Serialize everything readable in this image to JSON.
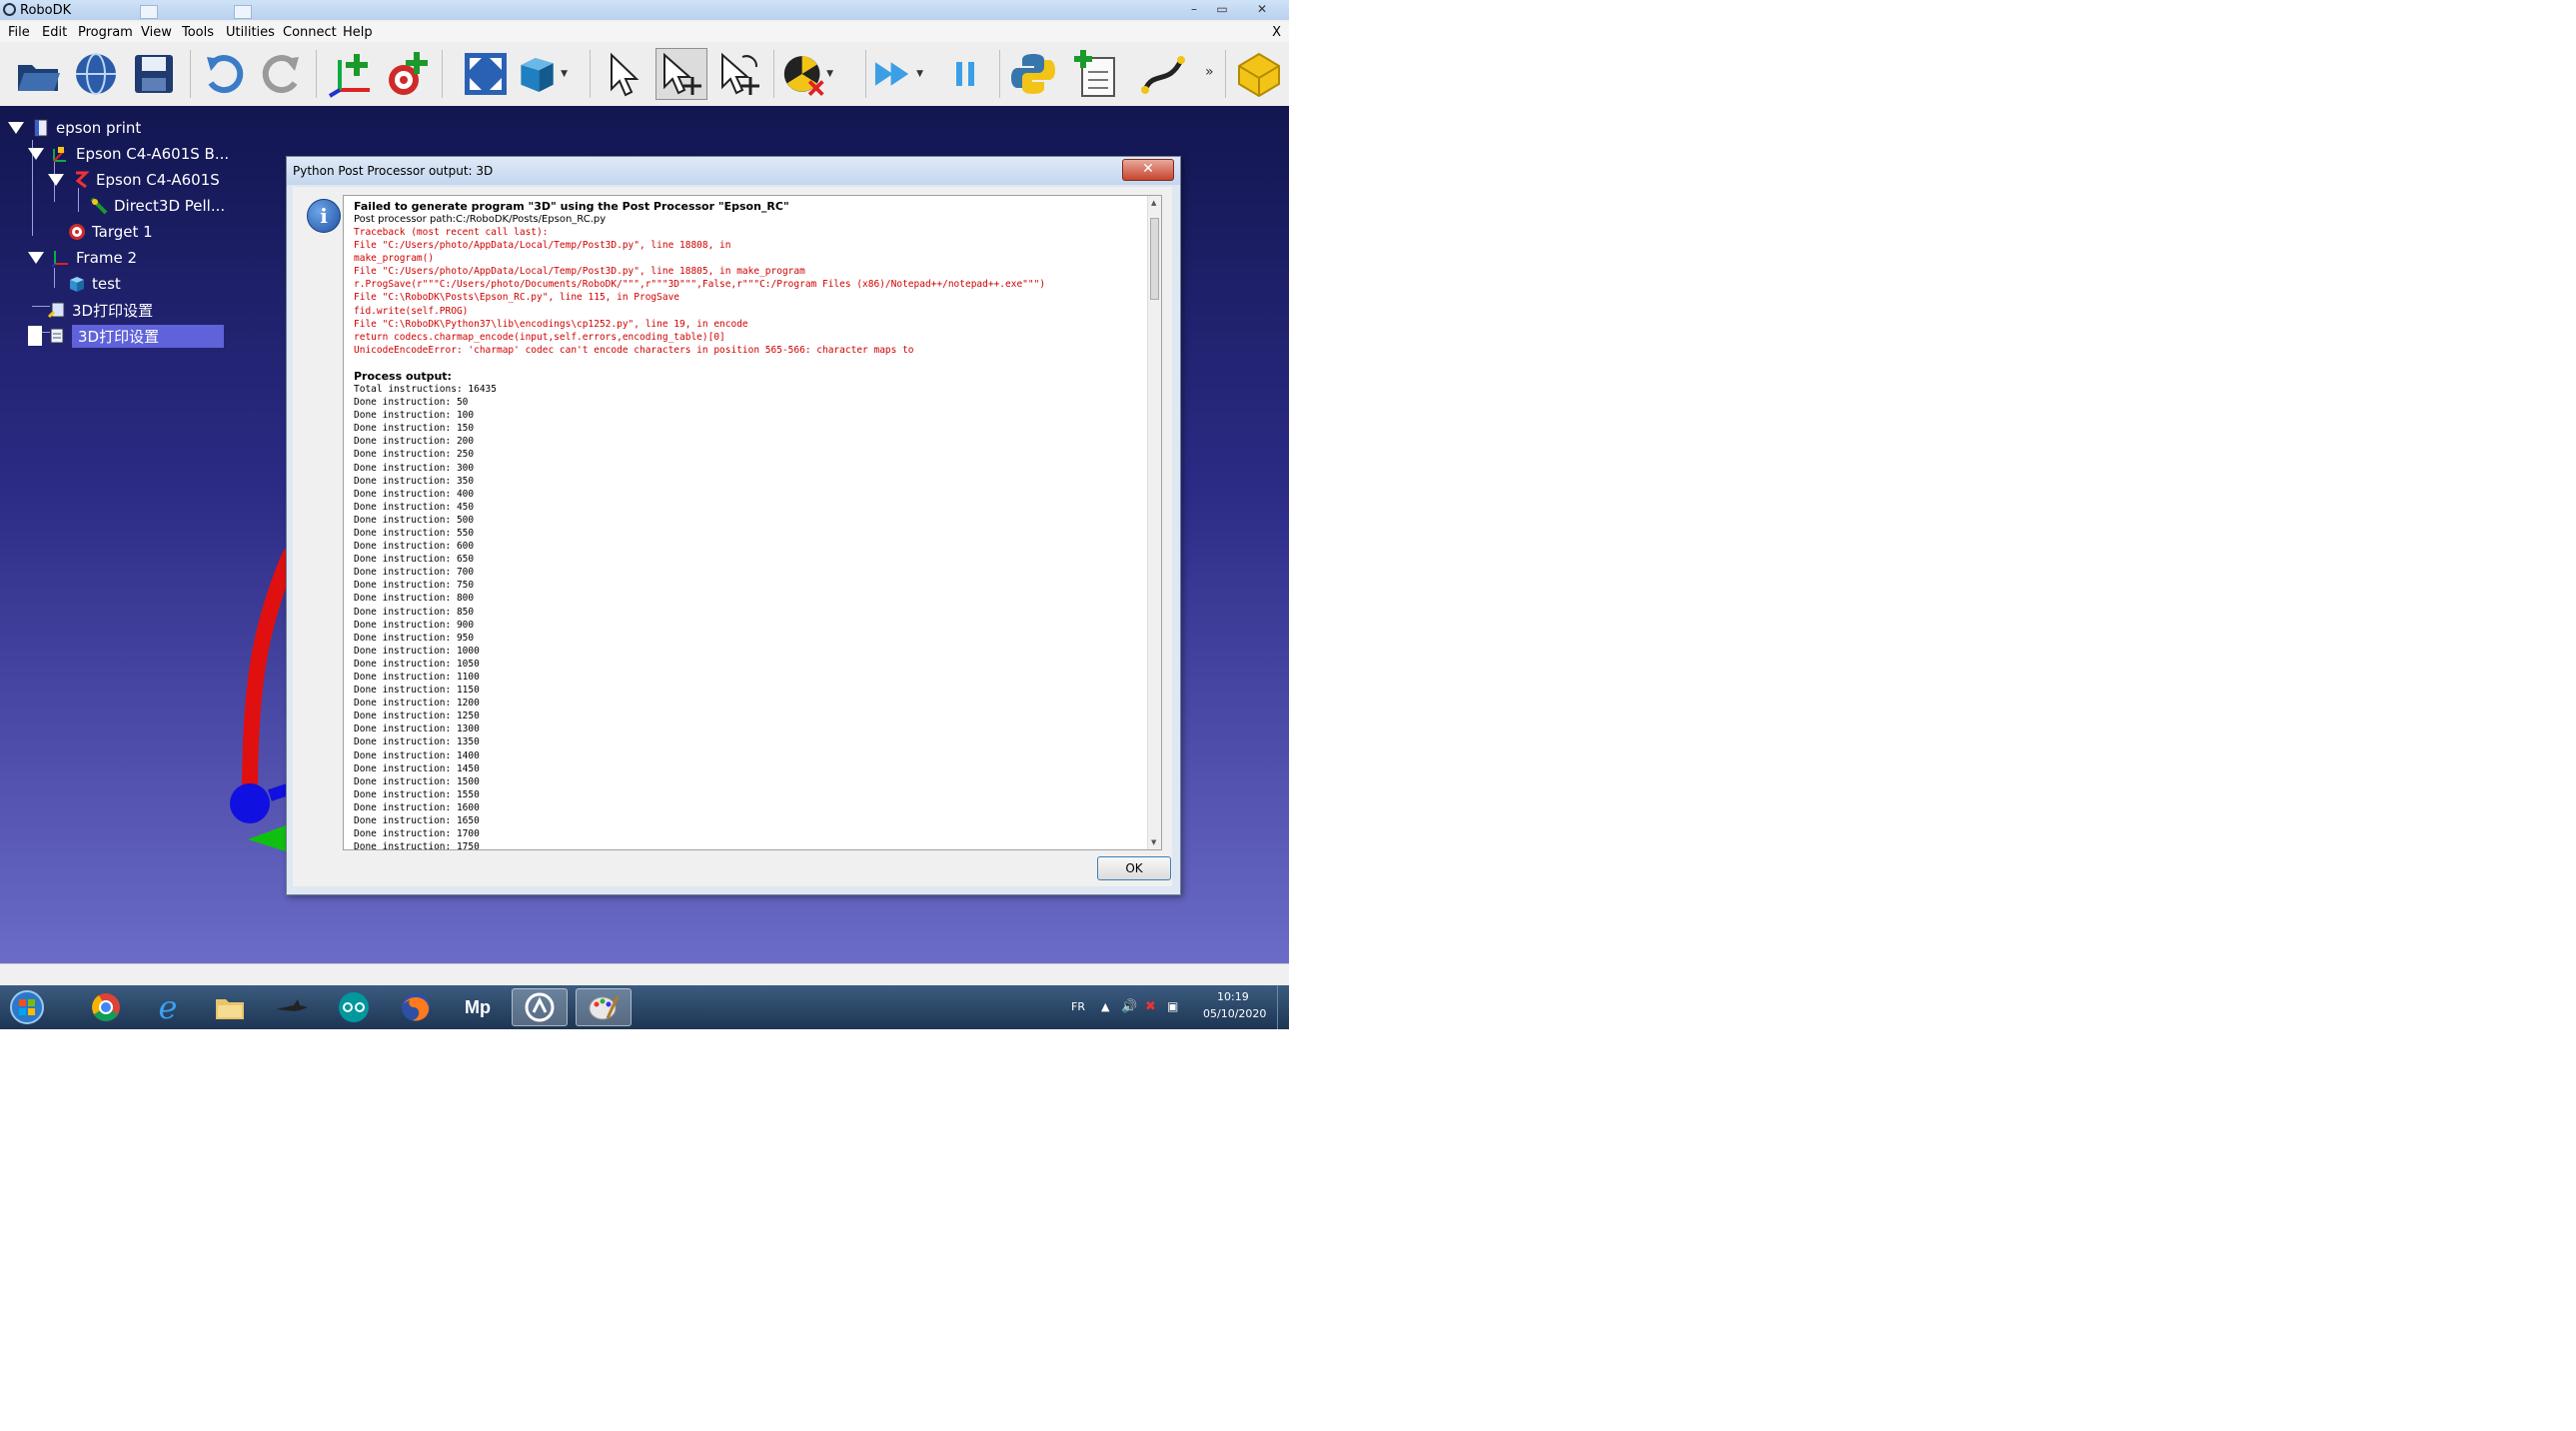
{
  "window": {
    "title": "RoboDK",
    "minimize": "–",
    "restore": "▭",
    "close": "✕"
  },
  "menu": {
    "items": [
      "File",
      "Edit",
      "Program",
      "View",
      "Tools",
      "Utilities",
      "Connect",
      "Help"
    ],
    "close": "X"
  },
  "toolbar": {
    "icons": [
      "open-icon",
      "web-library-icon",
      "save-icon",
      "undo-icon",
      "redo-icon",
      "add-frame-icon",
      "add-target-icon",
      "fit-all-icon",
      "view-cube-icon",
      "select-icon",
      "select-move-icon",
      "select-rotate-icon",
      "collision-icon",
      "run-program-icon",
      "pause-icon",
      "python-icon",
      "add-program-icon",
      "path-icon",
      "settings-icon"
    ],
    "more": "»"
  },
  "tree": {
    "items": [
      {
        "label": "epson print",
        "icon": "station-icon"
      },
      {
        "label": "Epson C4-A601S B...",
        "icon": "robot-base-icon"
      },
      {
        "label": "Epson C4-A601S",
        "icon": "robot-icon"
      },
      {
        "label": "Direct3D Pell...",
        "icon": "tool-icon"
      },
      {
        "label": "Target 1",
        "icon": "target-icon"
      },
      {
        "label": "Frame 2",
        "icon": "frame-icon"
      },
      {
        "label": "test",
        "icon": "object-icon"
      },
      {
        "label": "3D打印设置",
        "icon": "settings-item-icon"
      },
      {
        "label": "3D打印设置",
        "icon": "program-icon"
      }
    ]
  },
  "dialog": {
    "title": "Python Post Processor output: 3D",
    "close": "✕",
    "message_title": "Failed to generate program \"3D\" using the Post Processor \"Epson_RC\"",
    "path": "Post processor path:C:/RoboDK/Posts/Epson_RC.py",
    "traceback": [
      "Traceback (most recent call last):",
      "File \"C:/Users/photo/AppData/Local/Temp/Post3D.py\", line 18808, in",
      "make_program()",
      "File \"C:/Users/photo/AppData/Local/Temp/Post3D.py\", line 18805, in make_program",
      "r.ProgSave(r\"\"\"C:/Users/photo/Documents/RoboDK/\"\"\",r\"\"\"3D\"\"\",False,r\"\"\"C:/Program Files (x86)/Notepad++/notepad++.exe\"\"\")",
      "File \"C:\\RoboDK\\Posts\\Epson_RC.py\", line 115, in ProgSave",
      "fid.write(self.PROG)",
      "File \"C:\\RoboDK\\Python37\\lib\\encodings\\cp1252.py\", line 19, in encode",
      "return codecs.charmap_encode(input,self.errors,encoding_table)[0]",
      "UnicodeEncodeError: 'charmap' codec can't encode characters in position 565-566: character maps to"
    ],
    "output_heading": "Process output:",
    "output": [
      "Total instructions: 16435",
      "Done instruction: 50",
      "Done instruction: 100",
      "Done instruction: 150",
      "Done instruction: 200",
      "Done instruction: 250",
      "Done instruction: 300",
      "Done instruction: 350",
      "Done instruction: 400",
      "Done instruction: 450",
      "Done instruction: 500",
      "Done instruction: 550",
      "Done instruction: 600",
      "Done instruction: 650",
      "Done instruction: 700",
      "Done instruction: 750",
      "Done instruction: 800",
      "Done instruction: 850",
      "Done instruction: 900",
      "Done instruction: 950",
      "Done instruction: 1000",
      "Done instruction: 1050",
      "Done instruction: 1100",
      "Done instruction: 1150",
      "Done instruction: 1200",
      "Done instruction: 1250",
      "Done instruction: 1300",
      "Done instruction: 1350",
      "Done instruction: 1400",
      "Done instruction: 1450",
      "Done instruction: 1500",
      "Done instruction: 1550",
      "Done instruction: 1600",
      "Done instruction: 1650",
      "Done instruction: 1700",
      "Done instruction: 1750"
    ],
    "ok_label": "OK"
  },
  "taskbar": {
    "apps": [
      "start-orb-icon",
      "chrome-icon",
      "internet-explorer-icon",
      "file-explorer-icon",
      "shark-app-icon",
      "arduino-icon",
      "firefox-icon",
      "mp-app-icon",
      "robodk-icon",
      "paint-icon"
    ],
    "language": "FR",
    "time": "10:19",
    "date": "05/10/2020"
  },
  "colors": {
    "error_text": "#d00000",
    "viewport_top": "#121650",
    "viewport_bottom": "#6b6bc8",
    "tree_selected": "#5f62d8"
  }
}
